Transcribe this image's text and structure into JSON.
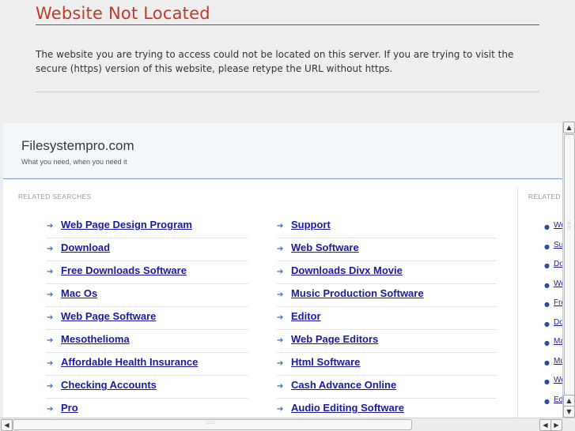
{
  "error": {
    "title": "Website Not Located",
    "message": "The website you are trying to access could not be located on this server. If you are trying to visit the secure (https) version of this website, please retype the URL without https."
  },
  "site": {
    "name": "Filesystempro.com",
    "tagline": "What you need, when you need it"
  },
  "related": {
    "heading": "RELATED SEARCHES",
    "side_heading": "RELATED",
    "col1": [
      "Web Page Design Program",
      "Download",
      "Free Downloads Software",
      "Mac Os",
      "Web Page Software",
      "Mesothelioma",
      "Affordable Health Insurance",
      "Checking Accounts",
      "Pro"
    ],
    "col2": [
      "Support",
      "Web Software",
      "Downloads Divx Movie",
      "Music Production Software",
      "Editor",
      "Web Page Editors",
      "Html Software",
      "Cash Advance Online",
      "Audio Editing Software"
    ],
    "side": [
      "We",
      "Su",
      "Do",
      "We",
      "Fre",
      "Do",
      "Ma",
      "Mu",
      "We",
      "Ed"
    ]
  },
  "colors": {
    "error_red": "#c0392b",
    "link_blue": "#1a1aa0",
    "header_line": "#7a9cc6"
  },
  "icons": {
    "list_arrow": "arrow-right-icon",
    "side_bullet": "bullet-icon"
  }
}
